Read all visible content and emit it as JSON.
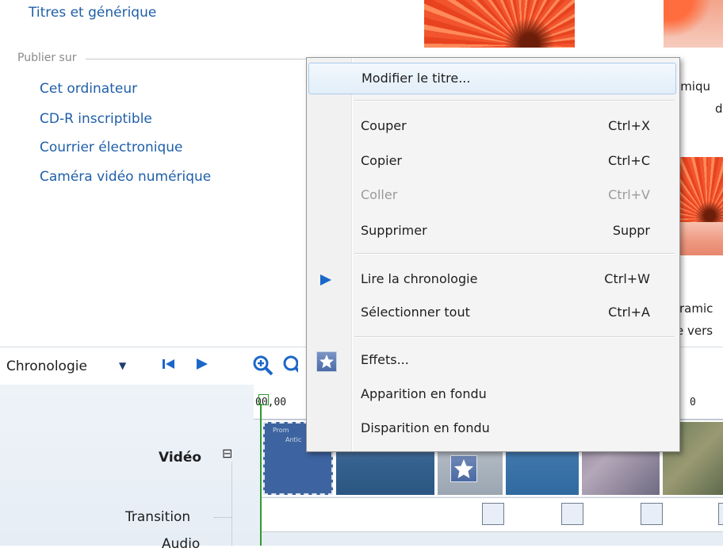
{
  "taskpane": {
    "partial_top_link": "Titres et générique",
    "publish_header": "Publier sur",
    "publish_links": [
      "Cet ordinateur",
      "CD-R inscriptible",
      "Courrier électronique",
      "Caméra vidéo numérique"
    ]
  },
  "thumbnails": {
    "caption_1a": "amiqu",
    "caption_1b": "d",
    "caption_2a": "ramic",
    "caption_2b": "e vers"
  },
  "timeline": {
    "label": "Chronologie",
    "dropdown_icon": "chevron-down-icon",
    "rewind_icon": "rewind-icon",
    "play_icon": "play-icon",
    "zoom_in_icon": "zoom-in-icon",
    "zoom_out_icon": "zoom-out-icon",
    "ruler_start": "00,00",
    "ruler_mid": "0",
    "track_video": "Vidéo",
    "collapse_symbol": "⊟",
    "track_transition": "Transition",
    "track_audio": "Audio",
    "clip_title_line1": "Prom",
    "clip_title_line2": "Antic"
  },
  "context_menu": {
    "items": [
      {
        "label": "Modifier le titre...",
        "shortcut": "",
        "state": "hover"
      },
      {
        "label": "Couper",
        "shortcut": "Ctrl+X",
        "state": "enabled"
      },
      {
        "label": "Copier",
        "shortcut": "Ctrl+C",
        "state": "enabled"
      },
      {
        "label": "Coller",
        "shortcut": "Ctrl+V",
        "state": "disabled"
      },
      {
        "label": "Supprimer",
        "shortcut": "Suppr",
        "state": "enabled"
      },
      {
        "label": "Lire la chronologie",
        "shortcut": "Ctrl+W",
        "state": "enabled",
        "icon": "play-icon"
      },
      {
        "label": "Sélectionner tout",
        "shortcut": "Ctrl+A",
        "state": "enabled"
      },
      {
        "label": "Effets...",
        "shortcut": "",
        "state": "enabled",
        "icon": "star-effects-icon"
      },
      {
        "label": "Apparition en fondu",
        "shortcut": "",
        "state": "enabled"
      },
      {
        "label": "Disparition en fondu",
        "shortcut": "",
        "state": "enabled"
      }
    ]
  },
  "colors": {
    "link": "#1f5fa8",
    "accent_blue": "#1b67c9",
    "menu_hover_border": "#aacbec",
    "timeline_cursor": "#2f9a2f"
  }
}
